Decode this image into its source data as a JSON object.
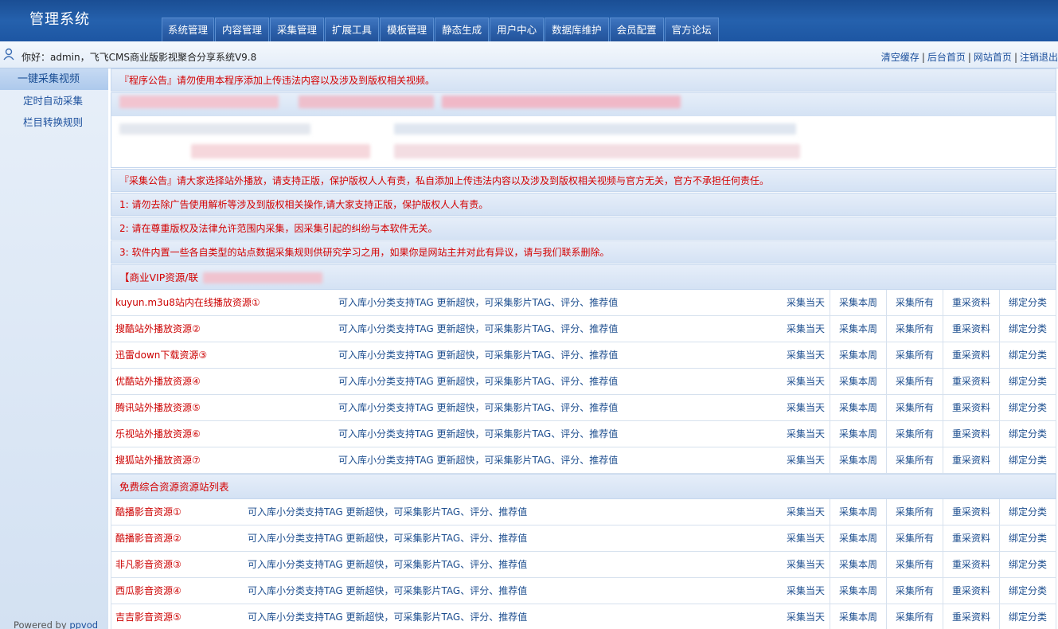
{
  "app": {
    "title": "管理系统"
  },
  "nav": [
    "系统管理",
    "内容管理",
    "采集管理",
    "扩展工具",
    "模板管理",
    "静态生成",
    "用户中心",
    "数据库维护",
    "会员配置",
    "官方论坛"
  ],
  "info": {
    "greeting": "你好：admin，飞飞CMS商业版影视聚合分享系统V9.8",
    "links": [
      "清空缓存",
      "后台首页",
      "网站首页",
      "注销退出"
    ]
  },
  "sidebar": {
    "items": [
      "一键采集视频",
      "定时自动采集",
      "栏目转换规则"
    ],
    "powered_prefix": "Powered by ",
    "powered_link": "ppvod"
  },
  "notices": {
    "program": "『程序公告』请勿使用本程序添加上传违法内容以及涉及到版权相关视频。",
    "collect": "『采集公告』请大家选择站外播放，请支持正版，保护版权人人有责，私自添加上传违法内容以及涉及到版权相关视频与官方无关，官方不承担任何责任。",
    "n1": "1: 请勿去除广告使用解析等涉及到版权相关操作,请大家支持正版，保护版权人人有责。",
    "n2": "2: 请在尊重版权及法律允许范围内采集，因采集引起的纠纷与本软件无关。",
    "n3": "3: 软件内置一些各自类型的站点数据采集规则供研究学习之用，如果你是网站主并对此有异议，请与我们联系删除。"
  },
  "vip": {
    "heading": "【商业VIP资源/联",
    "rows": [
      {
        "name": "kuyun.m3u8站内在线播放资源①",
        "desc": "可入库小分类支持TAG 更新超快，可采集影片TAG、评分、推荐值"
      },
      {
        "name": "搜酷站外播放资源②",
        "desc": "可入库小分类支持TAG 更新超快，可采集影片TAG、评分、推荐值"
      },
      {
        "name": "迅雷down下载资源③",
        "desc": "可入库小分类支持TAG 更新超快，可采集影片TAG、评分、推荐值"
      },
      {
        "name": "优酷站外播放资源④",
        "desc": "可入库小分类支持TAG 更新超快，可采集影片TAG、评分、推荐值"
      },
      {
        "name": "腾讯站外播放资源⑤",
        "desc": "可入库小分类支持TAG 更新超快，可采集影片TAG、评分、推荐值"
      },
      {
        "name": "乐视站外播放资源⑥",
        "desc": "可入库小分类支持TAG 更新超快，可采集影片TAG、评分、推荐值"
      },
      {
        "name": "搜狐站外播放资源⑦",
        "desc": "可入库小分类支持TAG 更新超快，可采集影片TAG、评分、推荐值"
      }
    ]
  },
  "free": {
    "heading": "免费综合资源资源站列表",
    "rows": [
      {
        "name": "酷播影音资源①",
        "desc": "可入库小分类支持TAG 更新超快，可采集影片TAG、评分、推荐值"
      },
      {
        "name": "酷播影音资源②",
        "desc": "可入库小分类支持TAG 更新超快，可采集影片TAG、评分、推荐值"
      },
      {
        "name": "非凡影音资源③",
        "desc": "可入库小分类支持TAG 更新超快，可采集影片TAG、评分、推荐值"
      },
      {
        "name": "西瓜影音资源④",
        "desc": "可入库小分类支持TAG 更新超快，可采集影片TAG、评分、推荐值"
      },
      {
        "name": "吉吉影音资源⑤",
        "desc": "可入库小分类支持TAG 更新超快，可采集影片TAG、评分、推荐值"
      }
    ]
  },
  "actions": [
    "采集当天",
    "采集本周",
    "采集所有",
    "重采资料",
    "绑定分类"
  ]
}
